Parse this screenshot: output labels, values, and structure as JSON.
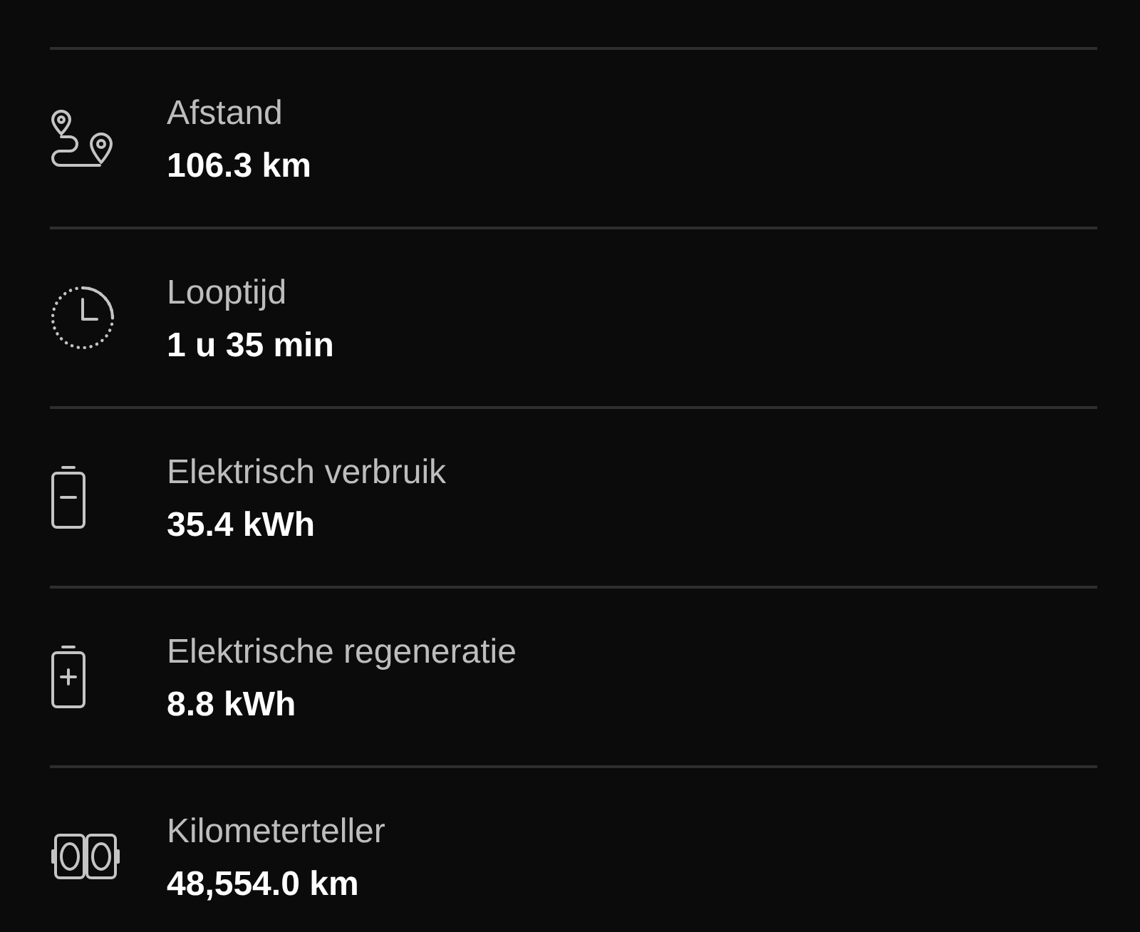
{
  "stats": [
    {
      "kind": "route",
      "label": "Afstand",
      "value": "106.3 km"
    },
    {
      "kind": "clock",
      "label": "Looptijd",
      "value": "1 u 35 min"
    },
    {
      "kind": "battery-minus",
      "label": "Elektrisch verbruik",
      "value": "35.4 kWh"
    },
    {
      "kind": "battery-plus",
      "label": "Elektrische regeneratie",
      "value": "8.8 kWh"
    },
    {
      "kind": "odometer",
      "label": "Kilometerteller",
      "value": "48,554.0 km"
    }
  ]
}
